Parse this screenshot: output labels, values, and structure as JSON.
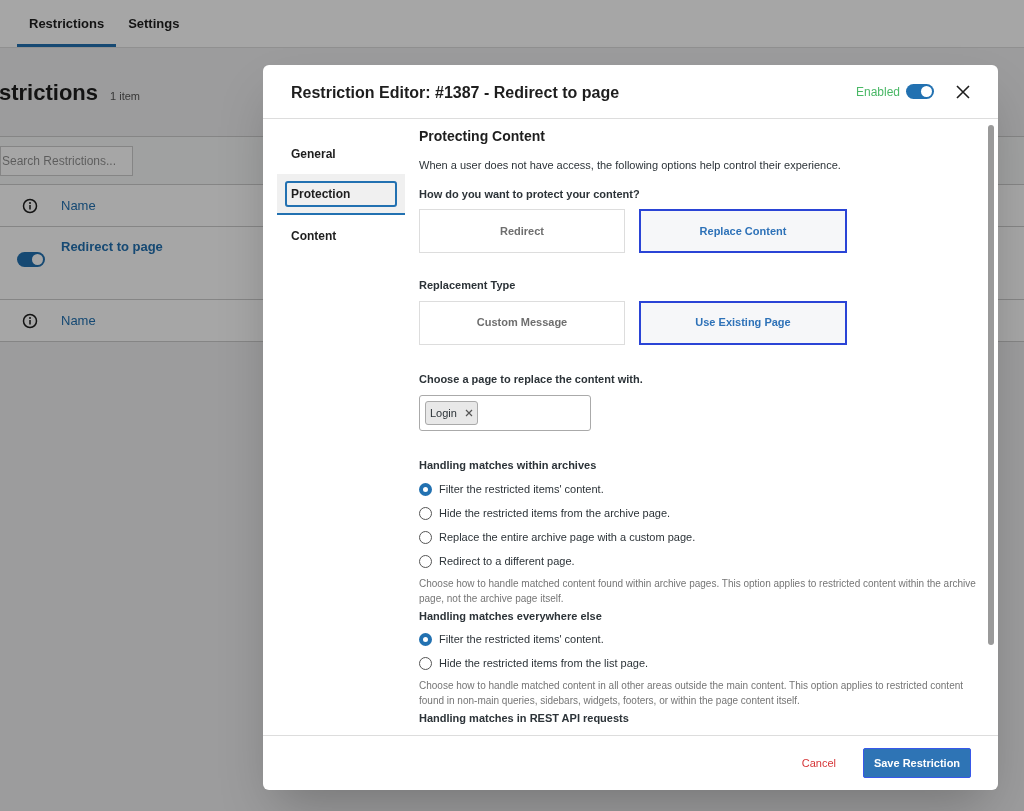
{
  "page": {
    "tabs": [
      {
        "label": "Restrictions",
        "selected": true
      },
      {
        "label": "Settings",
        "selected": false
      }
    ],
    "heading": "strictions",
    "count": "1 item",
    "search": {
      "placeholder": "Search Restrictions..."
    },
    "header_column": "Name",
    "rows": [
      {
        "enabled": true,
        "name": "Redirect to page"
      }
    ],
    "footer_column": "Name"
  },
  "modal": {
    "title": "Restriction Editor: #1387 - Redirect to page",
    "status_label": "Enabled",
    "enabled": true,
    "nav": [
      {
        "label": "General",
        "selected": false
      },
      {
        "label": "Protection",
        "selected": true
      },
      {
        "label": "Content",
        "selected": false
      }
    ],
    "section_title": "Protecting Content",
    "intro": "When a user does not have access, the following options help control their experience.",
    "fields": [
      {
        "kind": "choice",
        "label": "How do you want to protect your content?",
        "options": [
          {
            "label": "Redirect",
            "selected": false
          },
          {
            "label": "Replace Content",
            "selected": true
          }
        ]
      },
      {
        "kind": "choice",
        "label": "Replacement Type",
        "options": [
          {
            "label": "Custom Message",
            "selected": false
          },
          {
            "label": "Use Existing Page",
            "selected": true
          }
        ]
      },
      {
        "kind": "page_select",
        "label": "Choose a page to replace the content with.",
        "tags": [
          "Login"
        ]
      },
      {
        "kind": "radio",
        "label": "Handling matches within archives",
        "options": [
          {
            "label": "Filter the restricted items' content.",
            "selected": true
          },
          {
            "label": "Hide the restricted items from the archive page.",
            "selected": false
          },
          {
            "label": "Replace the entire archive page with a custom page.",
            "selected": false
          },
          {
            "label": "Redirect to a different page.",
            "selected": false
          }
        ],
        "help": "Choose how to handle matched content found within archive pages. This option applies to restricted content within the archive page, not the archive page itself."
      },
      {
        "kind": "radio",
        "label": "Handling matches everywhere else",
        "options": [
          {
            "label": "Filter the restricted items' content.",
            "selected": true
          },
          {
            "label": "Hide the restricted items from the list page.",
            "selected": false
          }
        ],
        "help": "Choose how to handle matched content in all other areas outside the main content. This option applies to restricted content found in non-main queries, sidebars, widgets, footers, or within the page content itself."
      },
      {
        "kind": "heading",
        "label": "Handling matches in REST API requests"
      }
    ],
    "cancel": "Cancel",
    "save": "Save Restriction"
  }
}
